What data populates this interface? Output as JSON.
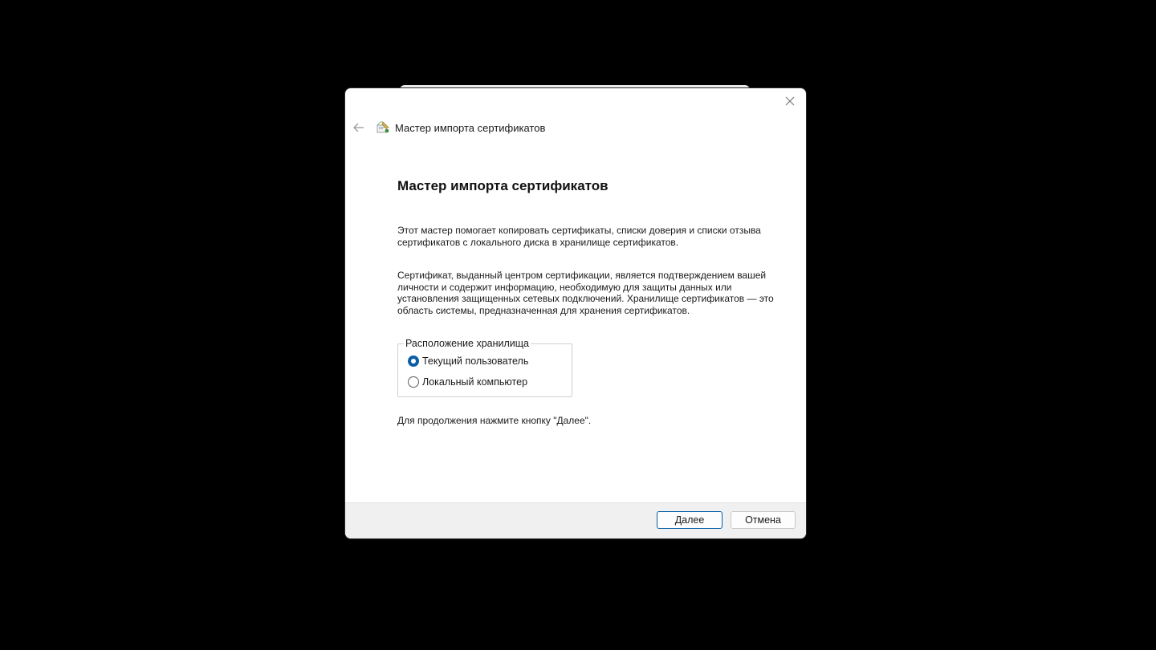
{
  "dialog": {
    "header_title": "Мастер импорта сертификатов",
    "page_title": "Мастер импорта сертификатов",
    "paragraph1": "Этот мастер помогает копировать сертификаты, списки доверия и списки отзыва сертификатов с локального диска в хранилище сертификатов.",
    "paragraph2": "Сертификат, выданный центром сертификации, является подтверждением вашей личности и содержит информацию, необходимую для защиты данных или установления защищенных сетевых подключений. Хранилище сертификатов — это область системы, предназначенная для хранения сертификатов.",
    "store_location": {
      "legend": "Расположение хранилища",
      "options": [
        {
          "label": "Текущий пользователь",
          "selected": true
        },
        {
          "label": "Локальный компьютер",
          "selected": false
        }
      ]
    },
    "continue_hint": "Для продолжения нажмите кнопку \"Далее\".",
    "buttons": {
      "next": "Далее",
      "cancel": "Отмена"
    },
    "icons": {
      "back": "arrow-left-icon",
      "wizard": "certificate-wizard-icon",
      "close": "close-icon"
    },
    "colors": {
      "accent": "#0a5ea8",
      "footer_bg": "#f0f0f0",
      "backdrop": "#000000"
    }
  }
}
